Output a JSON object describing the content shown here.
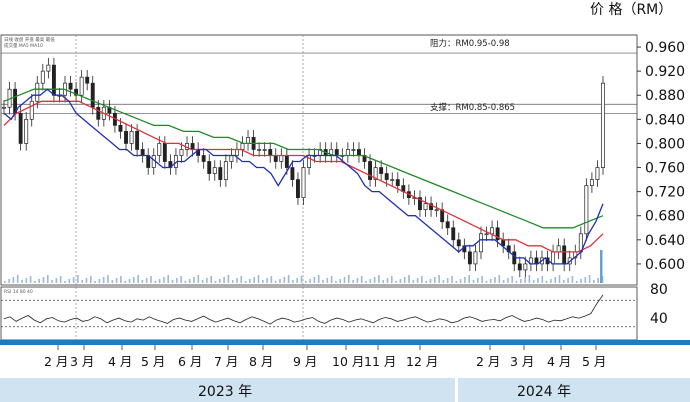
{
  "chart_data": {
    "type": "line",
    "title": "",
    "ylabel": "价 格（RM）",
    "ylim": [
      0.565,
      0.98
    ],
    "yticks": [
      0.6,
      0.64,
      0.68,
      0.72,
      0.76,
      0.8,
      0.84,
      0.88,
      0.92,
      0.96
    ],
    "ytick_labels": [
      "0.600",
      "0.640",
      "0.680",
      "0.720",
      "0.760",
      "0.800",
      "0.840",
      "0.880",
      "0.920",
      "0.960"
    ],
    "resistance": {
      "label": "阻力：RM0.95-0.98",
      "low": 0.95,
      "high": 0.98
    },
    "support": {
      "label": "支撑：RM0.85-0.865",
      "low": 0.85,
      "high": 0.865
    },
    "months_2023": [
      "2 月",
      "3 月",
      "4 月",
      "5 月",
      "6 月",
      "7 月",
      "8 月",
      "9 月",
      "10 月",
      "11 月",
      "12 月"
    ],
    "months_2024": [
      "2 月",
      "3 月",
      "4 月",
      "5 月"
    ],
    "years": [
      "2023 年",
      "2024 年"
    ],
    "indicator_ticks": [
      "80",
      "40"
    ],
    "price_close": [
      0.86,
      0.89,
      0.85,
      0.8,
      0.84,
      0.87,
      0.9,
      0.92,
      0.93,
      0.88,
      0.88,
      0.9,
      0.89,
      0.88,
      0.91,
      0.9,
      0.86,
      0.84,
      0.86,
      0.85,
      0.83,
      0.82,
      0.8,
      0.82,
      0.79,
      0.78,
      0.76,
      0.78,
      0.8,
      0.77,
      0.76,
      0.78,
      0.79,
      0.8,
      0.79,
      0.78,
      0.77,
      0.75,
      0.76,
      0.74,
      0.77,
      0.78,
      0.79,
      0.8,
      0.81,
      0.79,
      0.79,
      0.79,
      0.78,
      0.77,
      0.78,
      0.76,
      0.74,
      0.71,
      0.76,
      0.78,
      0.78,
      0.79,
      0.78,
      0.79,
      0.78,
      0.78,
      0.79,
      0.79,
      0.78,
      0.77,
      0.74,
      0.76,
      0.75,
      0.74,
      0.74,
      0.73,
      0.72,
      0.71,
      0.71,
      0.69,
      0.7,
      0.69,
      0.69,
      0.67,
      0.66,
      0.64,
      0.63,
      0.62,
      0.6,
      0.62,
      0.65,
      0.65,
      0.66,
      0.64,
      0.63,
      0.62,
      0.6,
      0.59,
      0.6,
      0.61,
      0.6,
      0.61,
      0.6,
      0.62,
      0.63,
      0.6,
      0.61,
      0.62,
      0.65,
      0.73,
      0.74,
      0.76,
      0.9
    ],
    "sma_short": [
      0.85,
      0.84,
      0.86,
      0.87,
      0.88,
      0.88,
      0.89,
      0.88,
      0.88,
      0.87,
      0.85,
      0.84,
      0.83,
      0.82,
      0.81,
      0.8,
      0.79,
      0.79,
      0.78,
      0.78,
      0.78,
      0.77,
      0.76,
      0.76,
      0.77,
      0.77,
      0.78,
      0.79,
      0.79,
      0.78,
      0.78,
      0.78,
      0.78,
      0.77,
      0.77,
      0.76,
      0.76,
      0.75,
      0.73,
      0.75,
      0.77,
      0.77,
      0.78,
      0.78,
      0.78,
      0.78,
      0.78,
      0.77,
      0.76,
      0.75,
      0.73,
      0.72,
      0.72,
      0.71,
      0.7,
      0.69,
      0.68,
      0.68,
      0.67,
      0.66,
      0.65,
      0.64,
      0.63,
      0.62,
      0.63,
      0.63,
      0.64,
      0.64,
      0.64,
      0.63,
      0.62,
      0.61,
      0.61,
      0.6,
      0.6,
      0.61,
      0.6,
      0.6,
      0.6,
      0.61,
      0.62,
      0.65,
      0.67,
      0.7
    ],
    "sma_mid": [
      0.83,
      0.85,
      0.86,
      0.87,
      0.87,
      0.87,
      0.87,
      0.86,
      0.85,
      0.84,
      0.83,
      0.82,
      0.81,
      0.8,
      0.8,
      0.79,
      0.79,
      0.79,
      0.79,
      0.79,
      0.78,
      0.78,
      0.78,
      0.78,
      0.78,
      0.77,
      0.77,
      0.77,
      0.76,
      0.75,
      0.74,
      0.73,
      0.72,
      0.71,
      0.7,
      0.69,
      0.68,
      0.67,
      0.66,
      0.65,
      0.64,
      0.64,
      0.63,
      0.63,
      0.62,
      0.62,
      0.62,
      0.63,
      0.65
    ],
    "sma_long": [
      0.87,
      0.88,
      0.89,
      0.89,
      0.89,
      0.88,
      0.87,
      0.86,
      0.85,
      0.84,
      0.83,
      0.83,
      0.82,
      0.82,
      0.81,
      0.81,
      0.8,
      0.8,
      0.8,
      0.79,
      0.79,
      0.79,
      0.78,
      0.78,
      0.78,
      0.77,
      0.76,
      0.75,
      0.74,
      0.73,
      0.72,
      0.71,
      0.7,
      0.69,
      0.68,
      0.67,
      0.66,
      0.66,
      0.66,
      0.67,
      0.68
    ],
    "indicator": [
      52,
      55,
      48,
      53,
      57,
      50,
      46,
      52,
      54,
      49,
      47,
      51,
      53,
      48,
      50,
      55,
      52,
      46,
      50,
      53,
      49,
      47,
      52,
      50,
      55,
      51,
      48,
      45,
      51,
      53,
      50,
      48,
      52,
      56,
      51,
      47,
      50,
      53,
      49,
      46,
      51,
      55,
      52,
      48,
      44,
      50,
      53,
      51,
      47,
      49,
      52,
      54,
      48,
      45,
      50,
      53,
      51,
      47,
      50,
      52,
      49,
      46,
      51,
      54,
      52,
      48,
      50,
      53,
      55,
      51,
      47,
      49,
      52,
      50,
      46,
      48,
      53,
      55,
      52,
      48,
      50,
      51,
      49,
      54,
      57,
      52,
      48,
      50,
      53,
      51,
      47,
      50,
      49,
      52,
      55,
      53,
      56,
      60,
      75,
      88
    ],
    "legend_tiny": [
      "日线 收盘 开盘 最高 最低",
      "成交量 MA5 MA10",
      "RSI 14 80 40"
    ]
  },
  "colors": {
    "ma_short": "#1f2fb8",
    "ma_mid": "#e0303a",
    "ma_long": "#1e8a2a",
    "candle": "#222222",
    "indicator": "#222222",
    "month_band": "#1f7bbf",
    "year_band": "#cfe3f1"
  }
}
